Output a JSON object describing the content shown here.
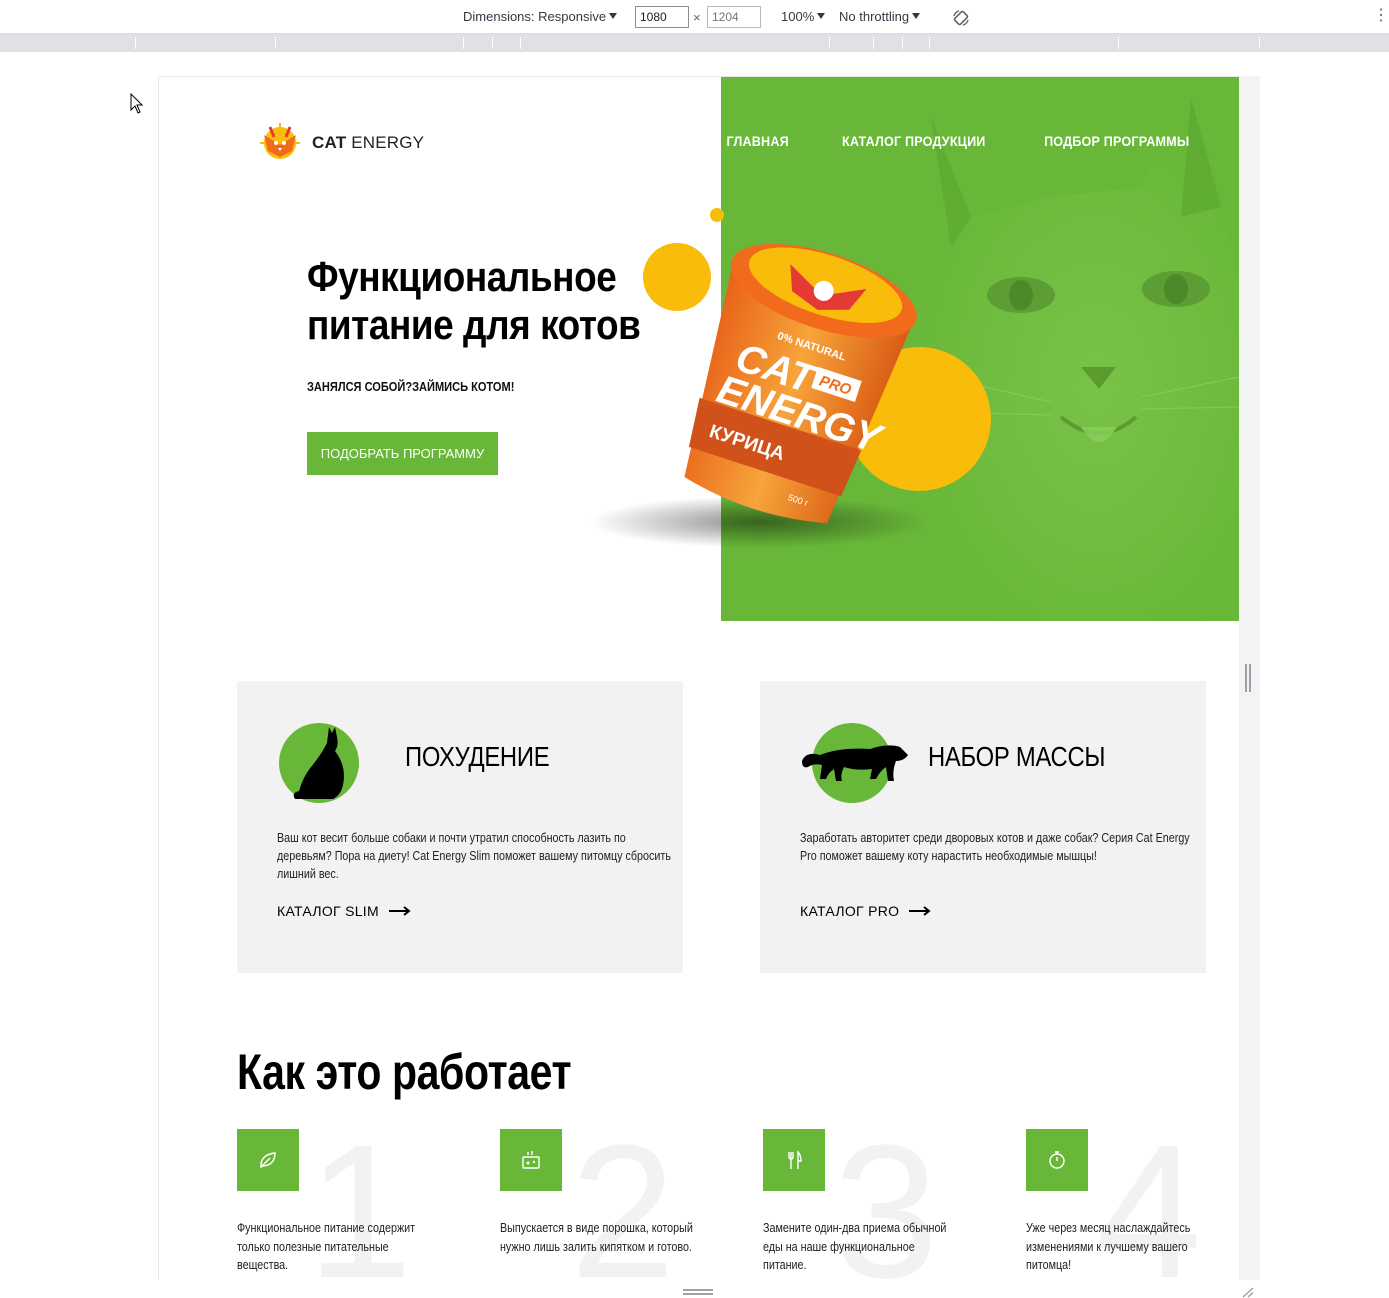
{
  "devtools": {
    "dimensions_label": "Dimensions: Responsive",
    "width_value": "1080",
    "height_placeholder": "1204",
    "times": "×",
    "zoom": "100%",
    "throttling": "No throttling",
    "rotate_icon": "rotate-icon",
    "more_icon": "kebab-menu-icon"
  },
  "header": {
    "logo_bold": "CAT",
    "logo_regular": " ENERGY",
    "nav": [
      "ГЛАВНАЯ",
      "КАТАЛОГ ПРОДУКЦИИ",
      "ПОДБОР ПРОГРАММЫ"
    ]
  },
  "hero": {
    "title": "Функциональное питание для котов",
    "subtitle": "ЗАНЯЛСЯ СОБОЙ?ЗАЙМИСЬ КОТОМ!",
    "button": "ПОДОБРАТЬ ПРОГРАММУ",
    "product": {
      "badge": "0% NATURAL",
      "brand_line1": "CAT",
      "brand_line2": "ENERGY",
      "tag": "PRO",
      "flavor": "КУРИЦА",
      "weight": "500 г"
    }
  },
  "programs": [
    {
      "title": "ПОХУДЕНИЕ",
      "text": "Ваш кот весит больше собаки и почти утратил способность лазить по деревьям? Пора на диету! Cat Energy Slim поможет вашему питомцу сбросить лишний вес.",
      "link": "КАТАЛОГ SLIM",
      "icon": "slim-cat-icon"
    },
    {
      "title": "НАБОР МАССЫ",
      "text": "Заработать авторитет среди дворовых котов и даже собак? Серия Cat Energy Pro поможет вашему коту нарастить необходимые мышцы!",
      "link": "КАТАЛОГ PRO",
      "icon": "panther-icon"
    }
  ],
  "how": {
    "title": "Как это работает",
    "steps": [
      {
        "num": "1",
        "text": "Функциональное питание содержит только полезные питательные вещества.",
        "icon": "leaf-icon"
      },
      {
        "num": "2",
        "text": "Выпускается в виде порошка, который нужно лишь залить кипятком и готово.",
        "icon": "powder-icon"
      },
      {
        "num": "3",
        "text": "Замените один-два приема обычной еды на наше функциональное питание.",
        "icon": "fork-knife-icon"
      },
      {
        "num": "4",
        "text": "Уже через месяц наслаждайтесь изменениями к лучшему вашего питомца!",
        "icon": "stopwatch-icon"
      }
    ]
  },
  "colors": {
    "brand_green": "#68b738",
    "accent_yellow": "#f9bc0a",
    "accent_orange": "#f26b1d",
    "card_bg": "#f2f2f2"
  }
}
